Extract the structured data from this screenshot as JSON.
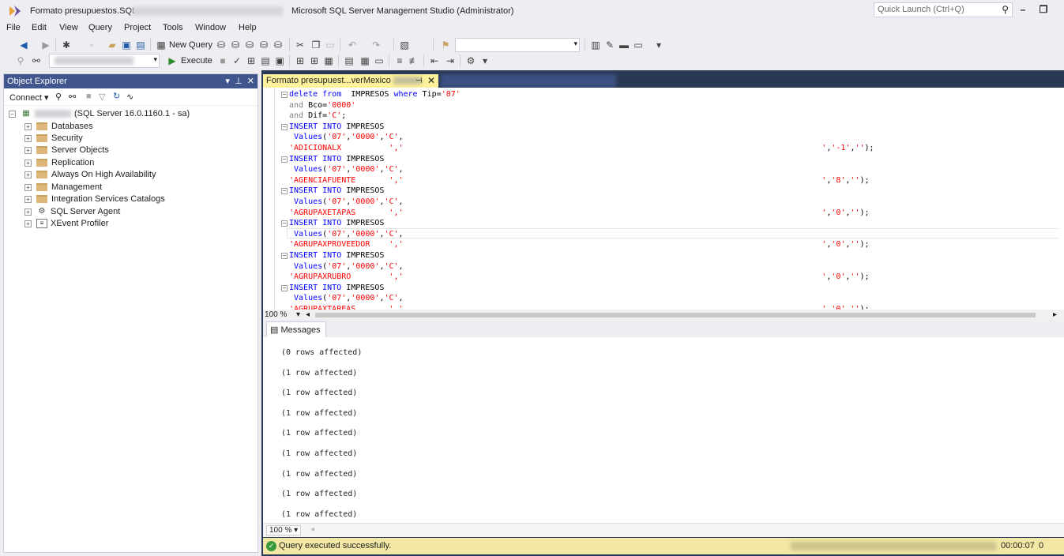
{
  "titlebar": {
    "doc_title": "Formato presupuestos.SQL",
    "app_title": "Microsoft SQL Server Management Studio (Administrator)",
    "quick_launch_placeholder": "Quick Launch (Ctrl+Q)"
  },
  "menu": [
    "File",
    "Edit",
    "View",
    "Query",
    "Project",
    "Tools",
    "Window",
    "Help"
  ],
  "toolbar": {
    "new_query": "New Query",
    "execute": "Execute"
  },
  "object_explorer": {
    "title": "Object Explorer",
    "connect_label": "Connect",
    "server_label": "(SQL Server 16.0.1160.1 - sa)",
    "nodes": [
      {
        "label": "Databases",
        "icon": "folder-icon"
      },
      {
        "label": "Security",
        "icon": "folder-icon"
      },
      {
        "label": "Server Objects",
        "icon": "folder-icon"
      },
      {
        "label": "Replication",
        "icon": "folder-icon"
      },
      {
        "label": "Always On High Availability",
        "icon": "folder-icon"
      },
      {
        "label": "Management",
        "icon": "folder-icon"
      },
      {
        "label": "Integration Services Catalogs",
        "icon": "folder-icon"
      },
      {
        "label": "SQL Server Agent",
        "icon": "agent-icon"
      },
      {
        "label": "XEvent Profiler",
        "icon": "profiler-icon"
      }
    ]
  },
  "editor": {
    "tab_label": "Formato presupuest...verMexico",
    "zoom": "100 %",
    "lines": [
      {
        "fold": true,
        "parts": [
          {
            "t": "kw",
            "v": "delete from"
          },
          {
            "t": "pl",
            "v": "  IMPRESOS "
          },
          {
            "t": "kw",
            "v": "where"
          },
          {
            "t": "pl",
            "v": " Tip="
          },
          {
            "t": "str",
            "v": "'07'"
          }
        ]
      },
      {
        "fold": false,
        "parts": [
          {
            "t": "gr",
            "v": "and"
          },
          {
            "t": "pl",
            "v": " Bco="
          },
          {
            "t": "str",
            "v": "'0000'"
          }
        ]
      },
      {
        "fold": false,
        "parts": [
          {
            "t": "gr",
            "v": "and"
          },
          {
            "t": "pl",
            "v": " Dif="
          },
          {
            "t": "str",
            "v": "'C'"
          },
          {
            "t": "pl",
            "v": ";"
          }
        ]
      },
      {
        "fold": true,
        "parts": [
          {
            "t": "kw",
            "v": "INSERT INTO"
          },
          {
            "t": "pl",
            "v": " IMPRESOS"
          }
        ]
      },
      {
        "fold": false,
        "parts": [
          {
            "t": "pl",
            "v": " "
          },
          {
            "t": "kw",
            "v": "Values"
          },
          {
            "t": "pl",
            "v": "("
          },
          {
            "t": "str",
            "v": "'07'"
          },
          {
            "t": "pl",
            "v": ","
          },
          {
            "t": "str",
            "v": "'0000'"
          },
          {
            "t": "pl",
            "v": ","
          },
          {
            "t": "str",
            "v": "'C'"
          },
          {
            "t": "pl",
            "v": ","
          }
        ]
      },
      {
        "fold": false,
        "parts": [
          {
            "t": "str",
            "v": "'ADICIONALX          ','                                                                                        '"
          },
          {
            "t": "pl",
            "v": ","
          },
          {
            "t": "str",
            "v": "'-1'"
          },
          {
            "t": "pl",
            "v": ","
          },
          {
            "t": "str",
            "v": "''"
          },
          {
            "t": "pl",
            "v": ");"
          }
        ]
      },
      {
        "fold": true,
        "parts": [
          {
            "t": "kw",
            "v": "INSERT INTO"
          },
          {
            "t": "pl",
            "v": " IMPRESOS"
          }
        ]
      },
      {
        "fold": false,
        "parts": [
          {
            "t": "pl",
            "v": " "
          },
          {
            "t": "kw",
            "v": "Values"
          },
          {
            "t": "pl",
            "v": "("
          },
          {
            "t": "str",
            "v": "'07'"
          },
          {
            "t": "pl",
            "v": ","
          },
          {
            "t": "str",
            "v": "'0000'"
          },
          {
            "t": "pl",
            "v": ","
          },
          {
            "t": "str",
            "v": "'C'"
          },
          {
            "t": "pl",
            "v": ","
          }
        ]
      },
      {
        "fold": false,
        "parts": [
          {
            "t": "str",
            "v": "'AGENCIAFUENTE       ','                                                                                        '"
          },
          {
            "t": "pl",
            "v": ","
          },
          {
            "t": "str",
            "v": "'8'"
          },
          {
            "t": "pl",
            "v": ","
          },
          {
            "t": "str",
            "v": "''"
          },
          {
            "t": "pl",
            "v": ");"
          }
        ]
      },
      {
        "fold": true,
        "parts": [
          {
            "t": "kw",
            "v": "INSERT INTO"
          },
          {
            "t": "pl",
            "v": " IMPRESOS"
          }
        ]
      },
      {
        "fold": false,
        "parts": [
          {
            "t": "pl",
            "v": " "
          },
          {
            "t": "kw",
            "v": "Values"
          },
          {
            "t": "pl",
            "v": "("
          },
          {
            "t": "str",
            "v": "'07'"
          },
          {
            "t": "pl",
            "v": ","
          },
          {
            "t": "str",
            "v": "'0000'"
          },
          {
            "t": "pl",
            "v": ","
          },
          {
            "t": "str",
            "v": "'C'"
          },
          {
            "t": "pl",
            "v": ","
          }
        ]
      },
      {
        "fold": false,
        "parts": [
          {
            "t": "str",
            "v": "'AGRUPAXETAPAS       ','                                                                                        '"
          },
          {
            "t": "pl",
            "v": ","
          },
          {
            "t": "str",
            "v": "'0'"
          },
          {
            "t": "pl",
            "v": ","
          },
          {
            "t": "str",
            "v": "''"
          },
          {
            "t": "pl",
            "v": ");"
          }
        ]
      },
      {
        "fold": true,
        "parts": [
          {
            "t": "kw",
            "v": "INSERT INTO"
          },
          {
            "t": "pl",
            "v": " IMPRESOS"
          }
        ]
      },
      {
        "fold": false,
        "parts": [
          {
            "t": "pl",
            "v": " "
          },
          {
            "t": "kw",
            "v": "Values"
          },
          {
            "t": "pl",
            "v": "("
          },
          {
            "t": "str",
            "v": "'07'"
          },
          {
            "t": "pl",
            "v": ","
          },
          {
            "t": "str",
            "v": "'0000'"
          },
          {
            "t": "pl",
            "v": ","
          },
          {
            "t": "str",
            "v": "'C'"
          },
          {
            "t": "pl",
            "v": ","
          }
        ]
      },
      {
        "fold": false,
        "parts": [
          {
            "t": "str",
            "v": "'AGRUPAXPROVEEDOR    ','                                                                                        '"
          },
          {
            "t": "pl",
            "v": ","
          },
          {
            "t": "str",
            "v": "'0'"
          },
          {
            "t": "pl",
            "v": ","
          },
          {
            "t": "str",
            "v": "''"
          },
          {
            "t": "pl",
            "v": ");"
          }
        ]
      },
      {
        "fold": true,
        "parts": [
          {
            "t": "kw",
            "v": "INSERT INTO"
          },
          {
            "t": "pl",
            "v": " IMPRESOS"
          }
        ]
      },
      {
        "fold": false,
        "parts": [
          {
            "t": "pl",
            "v": " "
          },
          {
            "t": "kw",
            "v": "Values"
          },
          {
            "t": "pl",
            "v": "("
          },
          {
            "t": "str",
            "v": "'07'"
          },
          {
            "t": "pl",
            "v": ","
          },
          {
            "t": "str",
            "v": "'0000'"
          },
          {
            "t": "pl",
            "v": ","
          },
          {
            "t": "str",
            "v": "'C'"
          },
          {
            "t": "pl",
            "v": ","
          }
        ]
      },
      {
        "fold": false,
        "parts": [
          {
            "t": "str",
            "v": "'AGRUPAXRUBRO        ','                                                                                        '"
          },
          {
            "t": "pl",
            "v": ","
          },
          {
            "t": "str",
            "v": "'0'"
          },
          {
            "t": "pl",
            "v": ","
          },
          {
            "t": "str",
            "v": "''"
          },
          {
            "t": "pl",
            "v": ");"
          }
        ]
      },
      {
        "fold": true,
        "parts": [
          {
            "t": "kw",
            "v": "INSERT INTO"
          },
          {
            "t": "pl",
            "v": " IMPRESOS"
          }
        ]
      },
      {
        "fold": false,
        "parts": [
          {
            "t": "pl",
            "v": " "
          },
          {
            "t": "kw",
            "v": "Values"
          },
          {
            "t": "pl",
            "v": "("
          },
          {
            "t": "str",
            "v": "'07'"
          },
          {
            "t": "pl",
            "v": ","
          },
          {
            "t": "str",
            "v": "'0000'"
          },
          {
            "t": "pl",
            "v": ","
          },
          {
            "t": "str",
            "v": "'C'"
          },
          {
            "t": "pl",
            "v": ","
          }
        ]
      },
      {
        "fold": false,
        "parts": [
          {
            "t": "str",
            "v": "'AGRUPAXTAREAS       ','                                                                                        '"
          },
          {
            "t": "pl",
            "v": ","
          },
          {
            "t": "str",
            "v": "'0'"
          },
          {
            "t": "pl",
            "v": ","
          },
          {
            "t": "str",
            "v": "''"
          },
          {
            "t": "pl",
            "v": ");"
          }
        ]
      }
    ]
  },
  "messages": {
    "tab_label": "Messages",
    "zoom": "100 %",
    "lines": [
      "(0 rows affected)",
      "(1 row affected)",
      "(1 row affected)",
      "(1 row affected)",
      "(1 row affected)",
      "(1 row affected)",
      "(1 row affected)",
      "(1 row affected)",
      "(1 row affected)"
    ]
  },
  "status": {
    "text": "Query executed successfully.",
    "elapsed": "00:00:07",
    "rows": "0 rows"
  },
  "colors": {
    "accent": "#40568d",
    "tab_active": "#fff29d",
    "status_bar": "#f2e7a4",
    "keyword": "#0000ff",
    "string": "#ff0000"
  }
}
